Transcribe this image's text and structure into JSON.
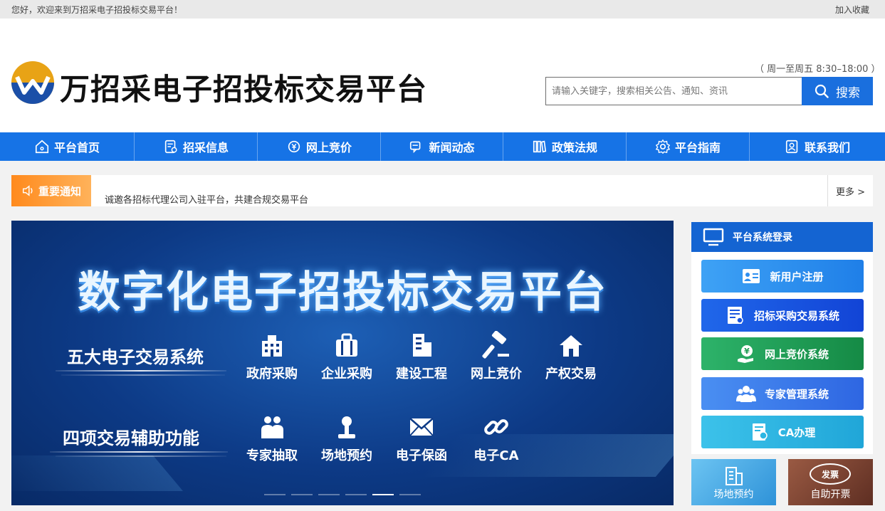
{
  "topbar": {
    "welcome": "您好，欢迎来到万招采电子招投标交易平台！",
    "favorite": "加入收藏"
  },
  "header": {
    "site_name": "万招采电子招投标交易平台",
    "hours": "（ 周一至周五 8:30–18:00 ）",
    "search_placeholder": "请输入关键字，搜索相关公告、通知、资讯",
    "search_button": "搜索"
  },
  "nav": [
    {
      "label": "平台首页",
      "icon": "home-icon"
    },
    {
      "label": "招采信息",
      "icon": "document-icon"
    },
    {
      "label": "网上竞价",
      "icon": "auction-icon"
    },
    {
      "label": "新闻动态",
      "icon": "chat-icon"
    },
    {
      "label": "政策法规",
      "icon": "books-icon"
    },
    {
      "label": "平台指南",
      "icon": "gear-icon"
    },
    {
      "label": "联系我们",
      "icon": "contact-icon"
    }
  ],
  "notice": {
    "tag": "重要通知",
    "text": "诚邀各招标代理公司入驻平台，共建合规交易平台",
    "more": "更多 >"
  },
  "banner": {
    "title": "数字化电子招投标交易平台",
    "group1": "五大电子交易系统",
    "group2": "四项交易辅助功能",
    "features1": [
      "政府采购",
      "企业采购",
      "建设工程",
      "网上竞价",
      "产权交易"
    ],
    "features2": [
      "专家抽取",
      "场地预约",
      "电子保函",
      "电子CA"
    ],
    "active_slide": 5,
    "slide_count": 6
  },
  "side": {
    "title": "平台系统登录",
    "buttons": [
      {
        "label": "新用户注册",
        "color": "#2e8ff0"
      },
      {
        "label": "招标采购交易系统",
        "color": "#1a55e0"
      },
      {
        "label": "网上竞价系统",
        "color": "#1f9e55"
      },
      {
        "label": "专家管理系统",
        "color": "#3a7bec"
      },
      {
        "label": "CA办理",
        "color": "#2bb6e3"
      }
    ]
  },
  "tiles": {
    "venue": "场地预约",
    "invoice": "自助开票",
    "invoice_stamp": "发票"
  }
}
